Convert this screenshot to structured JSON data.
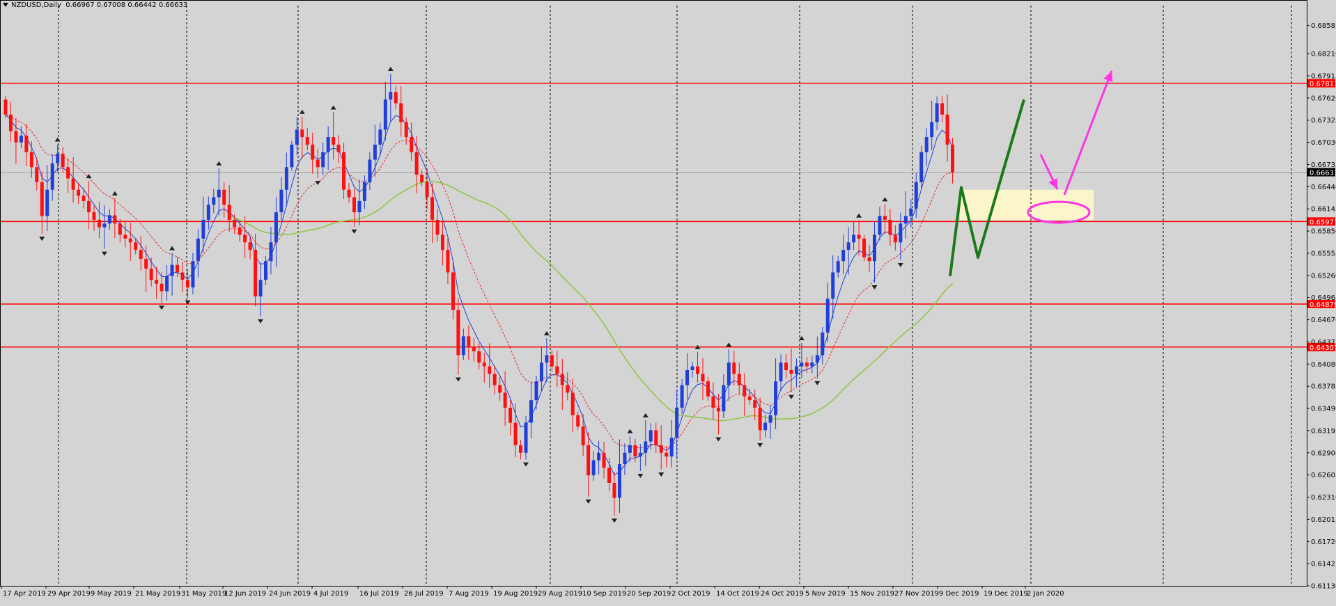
{
  "header": {
    "symbol": "NZDUSD,Daily",
    "ohlc": "0.66967 0.67008 0.66442 0.66633"
  },
  "colors": {
    "background": "#d4d4d4",
    "bull": "#1f3fd8",
    "bear": "#ff1010",
    "hline": "#ff0000",
    "ma_fast": "#1f3fd8",
    "ma_mid": "#e03030",
    "ma_slow": "#8cc63f",
    "pattern": "#1a7a1a",
    "annotation": "#ff33e6",
    "zone": "#fff8c8"
  },
  "chart_data": {
    "type": "candlestick",
    "symbol": "NZDUSD",
    "timeframe": "Daily",
    "ylim": [
      0.6113,
      0.6885
    ],
    "y_ticks": [
      "0.68585",
      "0.68210",
      "0.67915",
      "0.67620",
      "0.67325",
      "0.67030",
      "0.66735",
      "0.66440",
      "0.66145",
      "0.65850",
      "0.65555",
      "0.65260",
      "0.64965",
      "0.64670",
      "0.64375",
      "0.64080",
      "0.63785",
      "0.63490",
      "0.63195",
      "0.62900",
      "0.62605",
      "0.62310",
      "0.62015",
      "0.61720",
      "0.61425",
      "0.61130"
    ],
    "x_labels": [
      "17 Apr 2019",
      "29 Apr 2019",
      "9 May 2019",
      "21 May 2019",
      "31 May 2019",
      "12 Jun 2019",
      "24 Jun 2019",
      "4 Jul 2019",
      "16 Jul 2019",
      "26 Jul 2019",
      "7 Aug 2019",
      "19 Aug 2019",
      "29 Aug 2019",
      "10 Sep 2019",
      "20 Sep 2019",
      "2 Oct 2019",
      "14 Oct 2019",
      "24 Oct 2019",
      "5 Nov 2019",
      "15 Nov 2019",
      "27 Nov 2019",
      "9 Dec 2019",
      "19 Dec 2019",
      "2 Jan 2020"
    ],
    "horizontal_levels": [
      {
        "label": "0.67817",
        "value": 0.67817
      },
      {
        "label": "0.65977",
        "value": 0.65977
      },
      {
        "label": "0.64879",
        "value": 0.64879
      },
      {
        "label": "0.64307",
        "value": 0.64307
      }
    ],
    "current_price": {
      "label": "0.66633",
      "value": 0.66633
    },
    "closes": [
      0.674,
      0.6718,
      0.6703,
      0.6712,
      0.669,
      0.667,
      0.665,
      0.6605,
      0.664,
      0.6675,
      0.6688,
      0.667,
      0.6655,
      0.664,
      0.6632,
      0.6625,
      0.661,
      0.66,
      0.659,
      0.6595,
      0.6606,
      0.6595,
      0.658,
      0.6575,
      0.657,
      0.656,
      0.6548,
      0.6535,
      0.652,
      0.6515,
      0.6505,
      0.6525,
      0.654,
      0.653,
      0.652,
      0.651,
      0.6545,
      0.6575,
      0.66,
      0.662,
      0.663,
      0.664,
      0.662,
      0.66,
      0.659,
      0.658,
      0.657,
      0.656,
      0.6498,
      0.652,
      0.6545,
      0.657,
      0.661,
      0.664,
      0.667,
      0.67,
      0.672,
      0.671,
      0.67,
      0.668,
      0.667,
      0.669,
      0.671,
      0.67,
      0.669,
      0.664,
      0.663,
      0.661,
      0.6625,
      0.665,
      0.668,
      0.67,
      0.672,
      0.676,
      0.677,
      0.6755,
      0.673,
      0.671,
      0.669,
      0.666,
      0.665,
      0.663,
      0.66,
      0.658,
      0.656,
      0.653,
      0.648,
      0.642,
      0.6445,
      0.643,
      0.6425,
      0.641,
      0.6405,
      0.6395,
      0.638,
      0.637,
      0.635,
      0.633,
      0.63,
      0.629,
      0.633,
      0.636,
      0.6385,
      0.641,
      0.642,
      0.6405,
      0.6395,
      0.638,
      0.637,
      0.634,
      0.6325,
      0.63,
      0.626,
      0.628,
      0.629,
      0.627,
      0.625,
      0.623,
      0.6275,
      0.629,
      0.63,
      0.6285,
      0.629,
      0.6305,
      0.632,
      0.63,
      0.629,
      0.6285,
      0.631,
      0.635,
      0.638,
      0.64,
      0.6405,
      0.6395,
      0.6385,
      0.6365,
      0.635,
      0.6345,
      0.638,
      0.641,
      0.6395,
      0.638,
      0.6365,
      0.636,
      0.635,
      0.632,
      0.633,
      0.634,
      0.6385,
      0.641,
      0.64,
      0.6395,
      0.6405,
      0.641,
      0.6405,
      0.641,
      0.642,
      0.645,
      0.6495,
      0.653,
      0.6545,
      0.656,
      0.657,
      0.658,
      0.6575,
      0.655,
      0.6545,
      0.658,
      0.6605,
      0.66,
      0.658,
      0.657,
      0.6595,
      0.6605,
      0.6615,
      0.665,
      0.669,
      0.671,
      0.673,
      0.6755,
      0.674,
      0.67,
      0.6663
    ],
    "moving_averages": [
      {
        "name": "fast",
        "color": "#1f3fd8",
        "style": "solid"
      },
      {
        "name": "mid",
        "color": "#e03030",
        "style": "dashed"
      },
      {
        "name": "slow",
        "color": "#8cc63f",
        "style": "solid"
      }
    ],
    "vertical_separators": 13,
    "grid": false
  }
}
